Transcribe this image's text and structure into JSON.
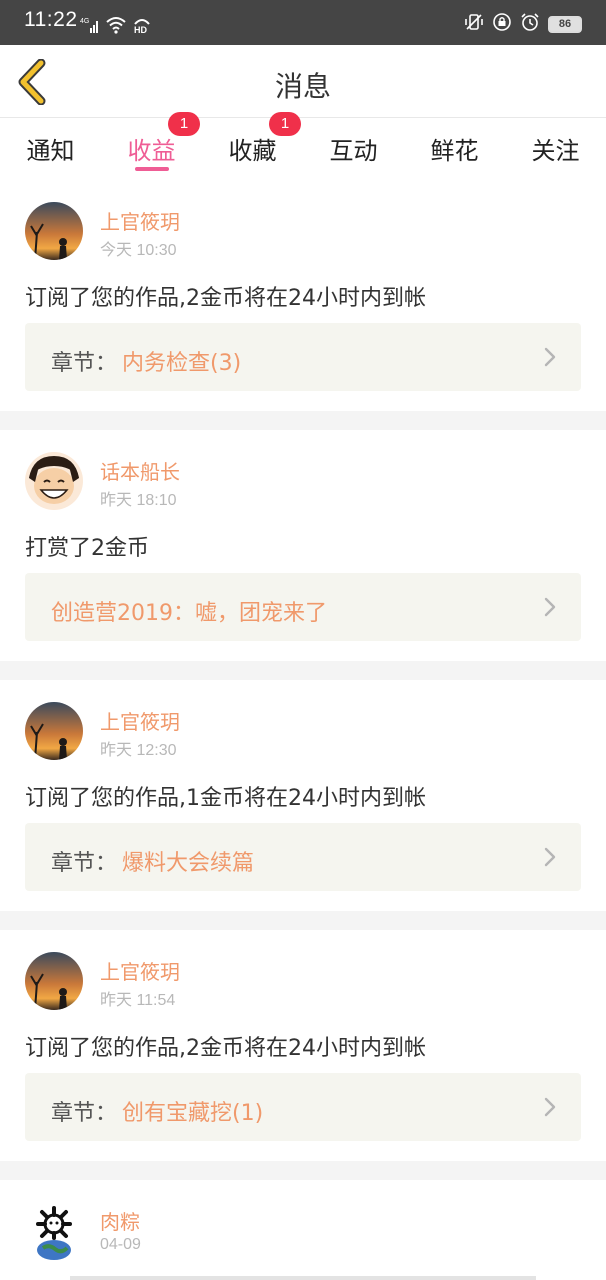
{
  "status_bar": {
    "time": "11:22",
    "network": "4G",
    "hd": "HD",
    "battery": "86"
  },
  "header": {
    "title": "消息"
  },
  "tabs": [
    {
      "label": "通知",
      "badge": "",
      "active": false
    },
    {
      "label": "收益",
      "badge": "1",
      "active": true
    },
    {
      "label": "收藏",
      "badge": "1",
      "active": false
    },
    {
      "label": "互动",
      "badge": "",
      "active": false
    },
    {
      "label": "鲜花",
      "badge": "",
      "active": false
    },
    {
      "label": "关注",
      "badge": "",
      "active": false
    }
  ],
  "messages": [
    {
      "user": "上官筱玥",
      "time": "今天 10:30",
      "text": "订阅了您的作品,2金币将在24小时内到帐",
      "ref_prefix": "章节：",
      "ref_title": "内务检查(3)"
    },
    {
      "user": "话本船长",
      "time": "昨天 18:10",
      "text": "打赏了2金币",
      "ref_prefix": "",
      "ref_title": "创造营2019：嘘，团宠来了"
    },
    {
      "user": "上官筱玥",
      "time": "昨天 12:30",
      "text": "订阅了您的作品,1金币将在24小时内到帐",
      "ref_prefix": "章节：",
      "ref_title": "爆料大会续篇"
    },
    {
      "user": "上官筱玥",
      "time": "昨天 11:54",
      "text": "订阅了您的作品,2金币将在24小时内到帐",
      "ref_prefix": "章节：",
      "ref_title": "创有宝藏挖(1)"
    },
    {
      "user": "肉粽",
      "time": "04-09"
    }
  ],
  "colors": {
    "accent_pink": "#ef5d95",
    "username_orange": "#f0996b",
    "badge_red": "#f0304a",
    "back_arrow_yellow": "#f2c12e"
  }
}
